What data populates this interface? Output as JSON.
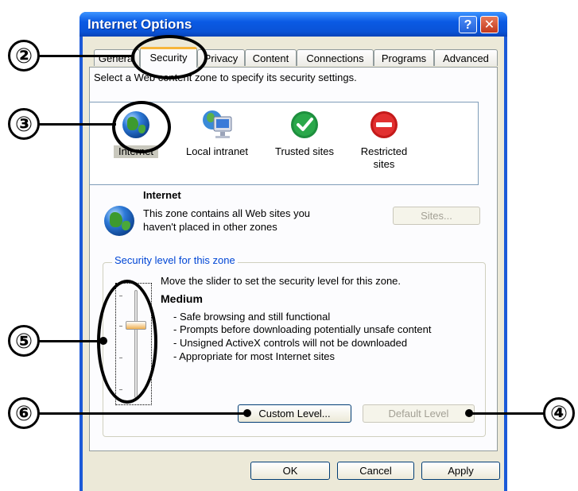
{
  "window": {
    "title": "Internet Options",
    "help_glyph": "?",
    "close_glyph": "✕"
  },
  "tabs": [
    {
      "label": "General"
    },
    {
      "label": "Security"
    },
    {
      "label": "Privacy"
    },
    {
      "label": "Content"
    },
    {
      "label": "Connections"
    },
    {
      "label": "Programs"
    },
    {
      "label": "Advanced"
    }
  ],
  "active_tab": "Security",
  "security": {
    "instruction": "Select a Web content zone to specify its security settings.",
    "zones": [
      {
        "label": "Internet",
        "icon": "globe-icon"
      },
      {
        "label": "Local intranet",
        "icon": "intranet-icon"
      },
      {
        "label": "Trusted sites",
        "icon": "checkmark-icon"
      },
      {
        "label": "Restricted sites",
        "icon": "restricted-icon"
      }
    ],
    "selected_zone": {
      "name": "Internet",
      "description_line1": "This zone contains all Web sites you",
      "description_line2": "haven't placed in other zones",
      "sites_button": "Sites..."
    },
    "level_group_label": "Security level for this zone",
    "slider_instruction": "Move the slider to set the security level for this zone.",
    "level_name": "Medium",
    "level_bullets": [
      "- Safe browsing and still functional",
      "- Prompts before downloading potentially unsafe content",
      "- Unsigned ActiveX controls will not be downloaded",
      "- Appropriate for most Internet sites"
    ],
    "custom_level_button": "Custom Level...",
    "default_level_button": "Default Level"
  },
  "footer": {
    "ok": "OK",
    "cancel": "Cancel",
    "apply": "Apply"
  },
  "callouts": {
    "c2": "②",
    "c3": "③",
    "c4": "④",
    "c5": "⑤",
    "c6": "⑥"
  },
  "colors": {
    "title_bar": "#0a53d6",
    "active_tab_accent": "#f7b53a",
    "group_label": "#0046d5"
  }
}
